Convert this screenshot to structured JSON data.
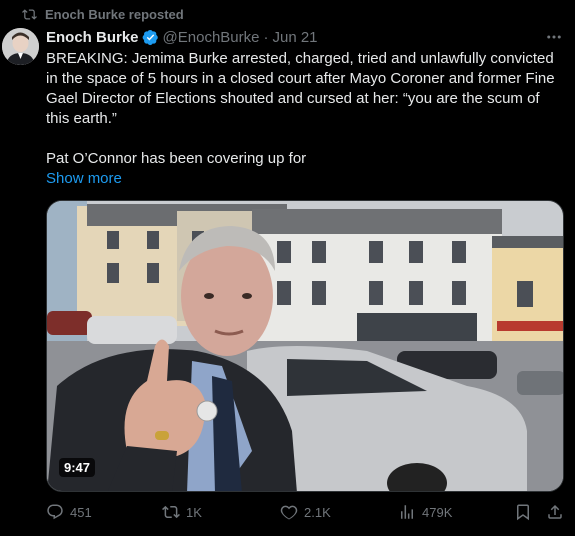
{
  "repost": {
    "label": "Enoch Burke reposted"
  },
  "author": {
    "name": "Enoch Burke",
    "handle": "@EnochBurke",
    "separator": "·",
    "date": "Jun 21"
  },
  "tweet": {
    "paragraph1": "BREAKING: Jemima Burke arrested, charged, tried and unlawfully convicted in the space of 5 hours in a closed court after Mayo Coroner and former Fine Gael Director of Elections shouted and cursed at her: “you are the scum of this earth.”",
    "paragraph2": "Pat O’Connor has been covering up for",
    "show_more": "Show more"
  },
  "media": {
    "duration": "9:47"
  },
  "actions": {
    "replies": "451",
    "reposts": "1K",
    "likes": "2.1K",
    "views": "479K"
  },
  "colors": {
    "accent": "#1d9bf0",
    "muted": "#71767b",
    "text": "#e7e9ea",
    "background": "#000000"
  }
}
